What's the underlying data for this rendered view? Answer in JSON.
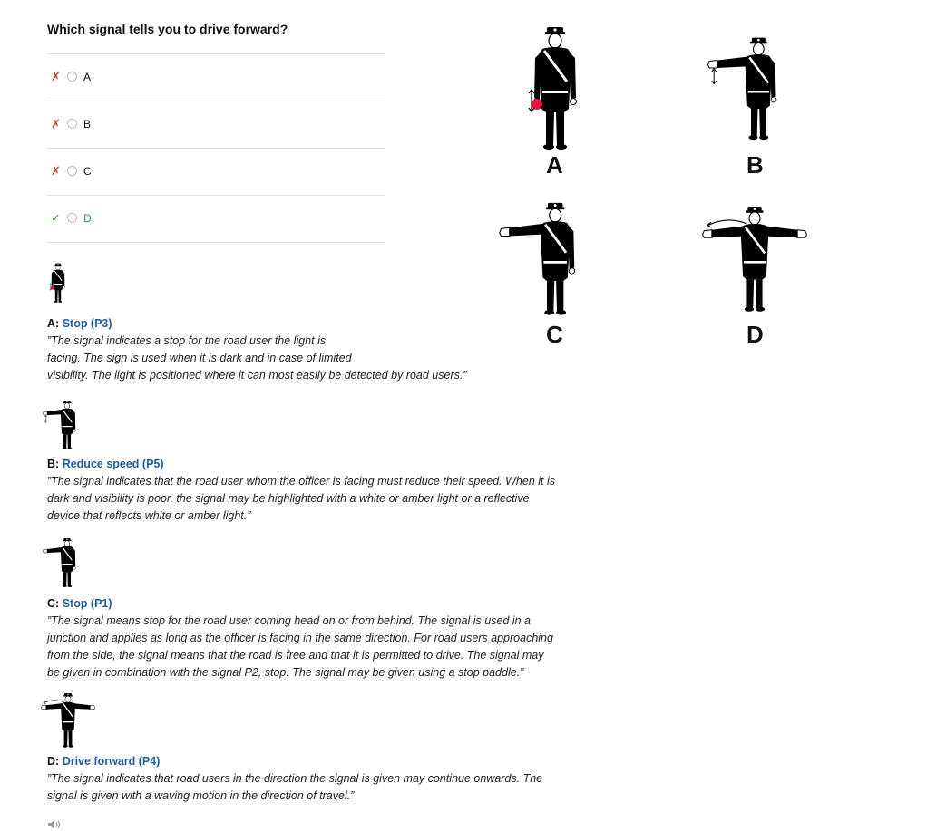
{
  "question": "Which signal tells you to drive forward?",
  "options": [
    {
      "mark": "✗",
      "label": "A",
      "status": "wrong"
    },
    {
      "mark": "✗",
      "label": "B",
      "status": "wrong"
    },
    {
      "mark": "✗",
      "label": "C",
      "status": "wrong"
    },
    {
      "mark": "✓",
      "label": "D",
      "status": "correct"
    }
  ],
  "figure_labels": [
    "A",
    "B",
    "C",
    "D"
  ],
  "explanations": [
    {
      "letter": "A:",
      "title": "Stop (P3)",
      "lines": [
        "”The signal indicates a stop for the road user the light is",
        "facing. The sign is used when it is dark and in case of limited",
        "visibility. The light is positioned where it can most easily be detected by road users.”"
      ]
    },
    {
      "letter": "B:",
      "title": "Reduce speed (P5)",
      "lines": [
        "”The signal indicates that the road user whom the officer is facing must reduce their speed. When it is",
        "dark and visibility is poor, the signal may be highlighted with a white or amber light or a reflective",
        "device that reflects white or amber light.”"
      ]
    },
    {
      "letter": "C:",
      "title": "Stop (P1)",
      "lines": [
        "”The signal means stop for the road user coming head on or from behind. The signal is used in a",
        "junction and applies as long as the officer is facing in the same direction. For road users approaching",
        "from the side, the signal means that the road is free and that it is permitted to drive. The signal may",
        "be given in combination with the signal P2, stop. The signal may be given using a stop paddle.”"
      ]
    },
    {
      "letter": "D:",
      "title": "Drive forward (P4)",
      "lines": [
        "”The signal indicates that road users in the direction the signal is given may continue onwards. The",
        "signal is given with a waving motion in the direction of travel.”"
      ]
    }
  ],
  "colors": {
    "wrong": "#d04040",
    "correct": "#2e9a2e",
    "link": "#1f5fa8",
    "lamp": "#e0143c"
  },
  "icons": {
    "sound": "speaker-icon"
  }
}
